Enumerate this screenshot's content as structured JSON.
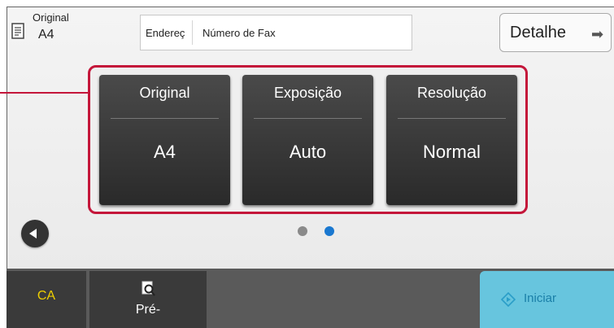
{
  "header": {
    "original_label": "Original",
    "original_size": "A4",
    "address_label": "Endereç",
    "address_value": "Número de Fax",
    "detail_button": "Detalhe",
    "detail_arrow": "➡"
  },
  "cards": [
    {
      "title": "Original",
      "value": "A4"
    },
    {
      "title": "Exposição",
      "value": "Auto"
    },
    {
      "title": "Resolução",
      "value": "Normal"
    }
  ],
  "pager": {
    "pages": 2,
    "active_page": 2
  },
  "bottom_bar": {
    "ca_label": "CA",
    "preview_label": "Pré-",
    "start_label": "Iniciar"
  },
  "colors": {
    "highlight": "#c4163a",
    "active_dot": "#1a78d0",
    "inactive_dot": "#8a8a8a",
    "ca_text": "#f0d000",
    "start_button": "#67c5de"
  },
  "icons": [
    "document-icon",
    "back-arrow-icon",
    "preview-icon",
    "start-icon",
    "arrow-right-icon"
  ]
}
